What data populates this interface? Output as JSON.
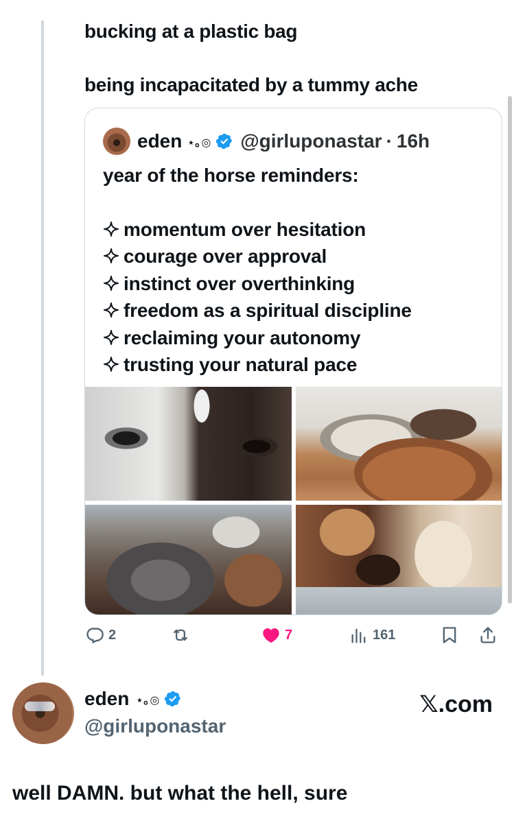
{
  "reply": {
    "line1": "bucking at a plastic bag",
    "line2": "being incapacitated by a tummy ache"
  },
  "quoted_post": {
    "author_name": "eden",
    "name_decoration": "⋆｡◎",
    "handle": "@girluponastar",
    "separator": "·",
    "time": "16h",
    "intro": "year of the horse reminders:",
    "items": [
      "momentum over hesitation",
      "courage over approval",
      "instinct over overthinking",
      "freedom as a spiritual discipline",
      "reclaiming your autonomy",
      "trusting your natural pace"
    ],
    "photos": [
      "horse-photo-1",
      "horse-photo-2",
      "horse-photo-3",
      "horse-photo-4"
    ]
  },
  "actions": {
    "replies": "2",
    "reposts": "",
    "likes": "7",
    "views": "161",
    "like_color": "#f91880",
    "muted_color": "#536471"
  },
  "author": {
    "name": "eden",
    "name_decoration": "⋆｡◎",
    "handle": "@girluponastar",
    "verified_color": "#1d9bf0",
    "site": "𝕏.com"
  },
  "main_text": "well DAMN. but what the hell, sure"
}
